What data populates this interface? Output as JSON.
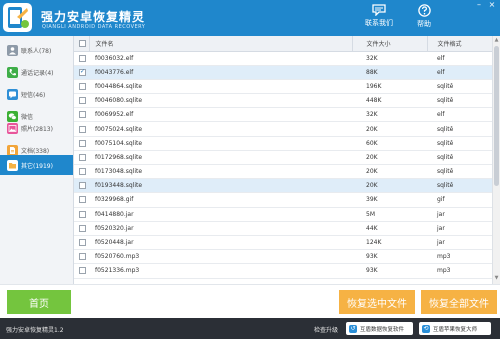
{
  "header": {
    "title": "强力安卓恢复精灵",
    "subtitle": "QIANGLI ANDROID DATA RECOVERY",
    "contact_label": "联系我们",
    "help_label": "帮助",
    "contact_icon": "chat-bubble-icon",
    "help_icon": "question-circle-icon",
    "minimize_glyph": "–",
    "close_glyph": "×"
  },
  "sidebar": {
    "items": [
      {
        "label": "联系人(78)",
        "icon": "contacts-icon",
        "color": "#8e9aa8"
      },
      {
        "label": "通话记录(4)",
        "icon": "phone-icon",
        "color": "#3fae49"
      },
      {
        "label": "短信(46)",
        "icon": "sms-icon",
        "color": "#2f8fd6"
      },
      {
        "label": "微信",
        "icon": "wechat-icon",
        "color": "#3cb034"
      },
      {
        "label": "照片(2813)",
        "icon": "photo-icon",
        "color": "#e8569b"
      },
      {
        "label": "文档(338)",
        "icon": "document-icon",
        "color": "#f2a53a"
      },
      {
        "label": "其它(1919)",
        "icon": "other-files-icon",
        "color": "#ffffff"
      }
    ],
    "active_index": 6
  },
  "table": {
    "columns": [
      "文件名",
      "文件大小",
      "文件格式"
    ],
    "rows": [
      {
        "name": "f0036032.elf",
        "size": "32K",
        "format": "elf",
        "checked": false
      },
      {
        "name": "f0043776.elf",
        "size": "88K",
        "format": "elf",
        "checked": true
      },
      {
        "name": "f0044864.sqlite",
        "size": "196K",
        "format": "sqlitê",
        "checked": false
      },
      {
        "name": "f0046080.sqlite",
        "size": "448K",
        "format": "sqlitê",
        "checked": false
      },
      {
        "name": "f0069952.elf",
        "size": "32K",
        "format": "elf",
        "checked": false
      },
      {
        "name": "f0075024.sqlite",
        "size": "20K",
        "format": "sqlitê",
        "checked": false
      },
      {
        "name": "f0075104.sqlite",
        "size": "60K",
        "format": "sqlitê",
        "checked": false
      },
      {
        "name": "f0172968.sqlite",
        "size": "20K",
        "format": "sqlitê",
        "checked": false
      },
      {
        "name": "f0173048.sqlite",
        "size": "20K",
        "format": "sqlitê",
        "checked": false
      },
      {
        "name": "f0193448.sqlite",
        "size": "20K",
        "format": "sqlitê",
        "checked": false
      },
      {
        "name": "f0329968.gif",
        "size": "39K",
        "format": "gif",
        "checked": false
      },
      {
        "name": "f0414880.jar",
        "size": "5M",
        "format": "jar",
        "checked": false
      },
      {
        "name": "f0520320.jar",
        "size": "44K",
        "format": "jar",
        "checked": false
      },
      {
        "name": "f0520448.jar",
        "size": "124K",
        "format": "jar",
        "checked": false
      },
      {
        "name": "f0520760.mp3",
        "size": "93K",
        "format": "mp3",
        "checked": false
      },
      {
        "name": "f0521336.mp3",
        "size": "93K",
        "format": "mp3",
        "checked": false
      }
    ],
    "highlight_rows": [
      1,
      9
    ]
  },
  "actions": {
    "home_label": "首页",
    "recover_selected_label": "恢复选中文件",
    "recover_all_label": "恢复全部文件"
  },
  "status": {
    "version": "强力安卓恢复精灵1.2",
    "check_update": "检查升级",
    "link1_label": "互盾数据恢复软件",
    "link2_label": "互盾苹果恢复大师"
  },
  "colors": {
    "brand_blue": "#1f87cc",
    "home_green": "#74c53e",
    "recover_orange": "#f6b244",
    "status_dark": "#2b2f36"
  }
}
